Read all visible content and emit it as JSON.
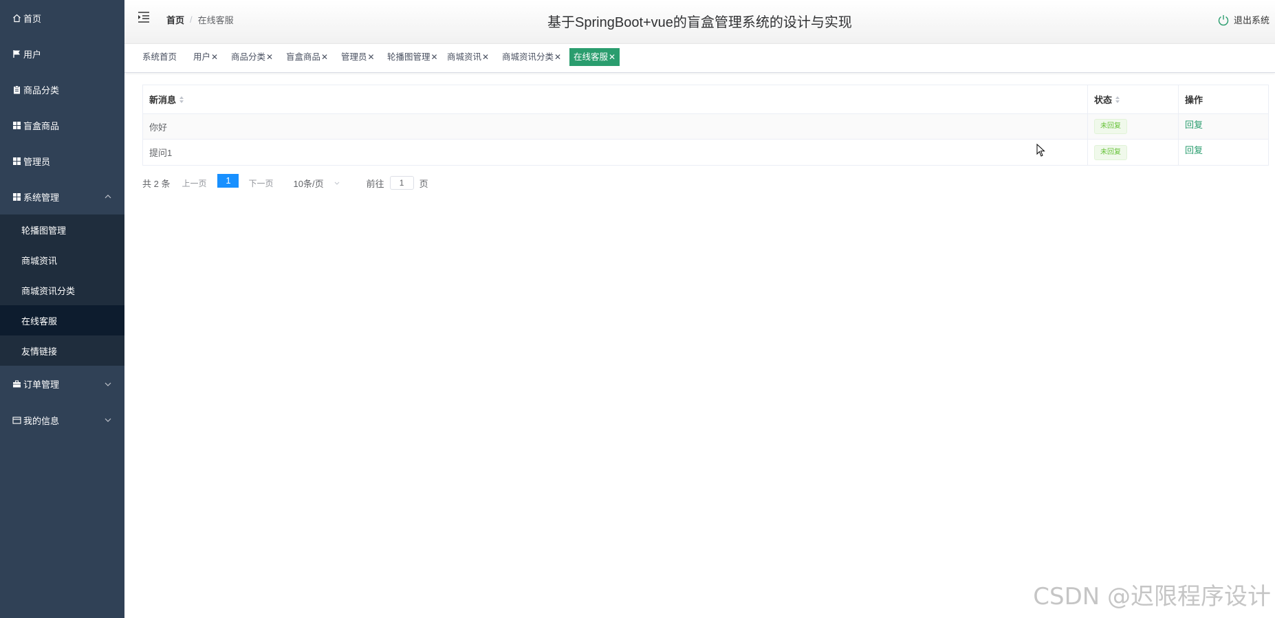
{
  "sidebar": {
    "items": [
      {
        "label": "首页",
        "icon": "home-icon"
      },
      {
        "label": "用户",
        "icon": "flag-icon"
      },
      {
        "label": "商品分类",
        "icon": "clipboard-icon"
      },
      {
        "label": "盲盒商品",
        "icon": "grid-icon"
      },
      {
        "label": "管理员",
        "icon": "grid-icon"
      },
      {
        "label": "系统管理",
        "icon": "grid-icon",
        "expanded": true
      }
    ],
    "submenu": [
      "轮播图管理",
      "商城资讯",
      "商城资讯分类",
      "在线客服",
      "友情链接"
    ],
    "active_sub": "在线客服",
    "bottom_items": [
      {
        "label": "订单管理",
        "icon": "briefcase-icon"
      },
      {
        "label": "我的信息",
        "icon": "card-icon"
      }
    ]
  },
  "header": {
    "breadcrumb_home": "首页",
    "breadcrumb_sep": "/",
    "breadcrumb_current": "在线客服",
    "title": "基于SpringBoot+vue的盲盒管理系统的设计与实现",
    "logout": "退出系统"
  },
  "tags": [
    {
      "label": "系统首页",
      "closable": false
    },
    {
      "label": "用户",
      "closable": true
    },
    {
      "label": "商品分类",
      "closable": true
    },
    {
      "label": "盲盒商品",
      "closable": true
    },
    {
      "label": "管理员",
      "closable": true
    },
    {
      "label": "轮播图管理",
      "closable": true
    },
    {
      "label": "商城资讯",
      "closable": true
    },
    {
      "label": "商城资讯分类",
      "closable": true
    },
    {
      "label": "在线客服",
      "closable": true,
      "active": true
    }
  ],
  "table": {
    "columns": [
      "新消息",
      "状态",
      "操作"
    ],
    "rows": [
      {
        "message": "你好",
        "status": "未回复",
        "action": "回复"
      },
      {
        "message": "提问1",
        "status": "未回复",
        "action": "回复"
      }
    ]
  },
  "pagination": {
    "total": "共 2 条",
    "prev": "上一页",
    "current_page": "1",
    "next": "下一页",
    "page_size": "10条/页",
    "goto_label": "前往",
    "goto_value": "1",
    "goto_suffix": "页"
  },
  "watermark": "CSDN @迟限程序设计",
  "colors": {
    "sidebar_bg": "#304156",
    "submenu_bg": "#1f2d3d",
    "active_tag": "#2a9d6e",
    "page_active": "#1890ff",
    "status_badge": "#67c23a"
  }
}
